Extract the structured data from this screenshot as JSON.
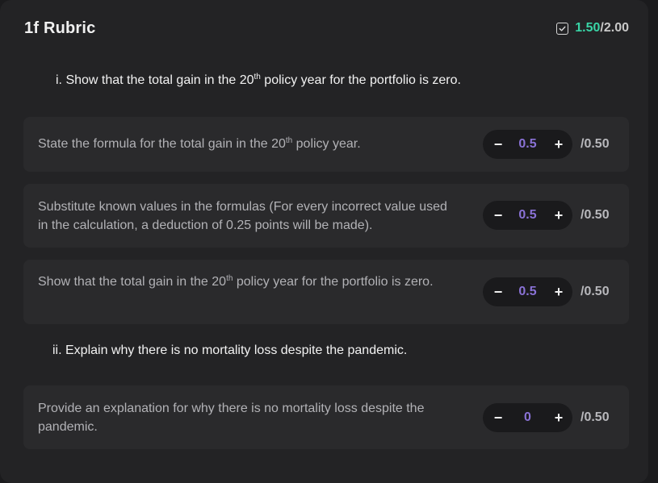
{
  "rubric": {
    "title": "1f Rubric",
    "score_earned": "1.50",
    "score_sep": "/",
    "score_total": "2.00"
  },
  "questions": [
    {
      "pre": "i. Show that the total gain in the 20",
      "sup": "th",
      "post": " policy year for the portfolio is zero."
    },
    {
      "pre": "ii. Explain why there is no mortality loss despite the pandemic.",
      "sup": "",
      "post": ""
    }
  ],
  "criteria": [
    {
      "pre": "State the formula for the total gain in the 20",
      "sup": "th",
      "post": " policy year.",
      "value": "0.5",
      "max": "/0.50"
    },
    {
      "pre": "Substitute known values in the formulas (For every incorrect value used in the calculation, a deduction of 0.25 points will be made).",
      "sup": "",
      "post": "",
      "value": "0.5",
      "max": "/0.50"
    },
    {
      "pre": "Show that the total gain in the 20",
      "sup": "th",
      "post": " policy year for the portfolio is zero.",
      "value": "0.5",
      "max": "/0.50"
    },
    {
      "pre": "Provide an explanation for why there is no mortality loss despite the pandemic.",
      "sup": "",
      "post": "",
      "value": "0",
      "max": "/0.50"
    }
  ],
  "controls": {
    "decrement_symbol": "−",
    "increment_symbol": "+"
  },
  "icons": {
    "score_icon": "checkbox-check-icon"
  },
  "colors": {
    "earned": "#39d4a6",
    "value": "#8a72d6"
  }
}
